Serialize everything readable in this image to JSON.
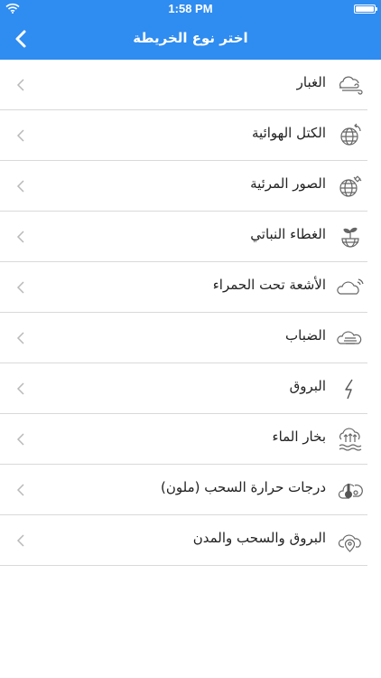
{
  "status_bar": {
    "time": "1:58 PM",
    "wifi_icon": "wifi-icon",
    "battery_icon": "battery-icon"
  },
  "nav": {
    "title": "اختر نوع الخريطة",
    "back_icon": "chevron-left-icon",
    "bar_color": "#2f8cf0"
  },
  "items": [
    {
      "label": "الغبار",
      "icon": "dust-cloud-icon"
    },
    {
      "label": "الكتل الهوائية",
      "icon": "globe-air-mass-icon"
    },
    {
      "label": "الصور المرئية",
      "icon": "globe-satellite-icon"
    },
    {
      "label": "الغطاء النباتي",
      "icon": "globe-plant-icon"
    },
    {
      "label": "الأشعة تحت الحمراء",
      "icon": "cloud-infrared-icon"
    },
    {
      "label": "الضباب",
      "icon": "fog-cloud-icon"
    },
    {
      "label": "البروق",
      "icon": "lightning-icon"
    },
    {
      "label": "بخار الماء",
      "icon": "water-vapor-icon"
    },
    {
      "label": "درجات حرارة السحب (ملون)",
      "icon": "cloud-temperature-icon"
    },
    {
      "label": "البروق والسحب والمدن",
      "icon": "cloud-location-icon"
    }
  ]
}
